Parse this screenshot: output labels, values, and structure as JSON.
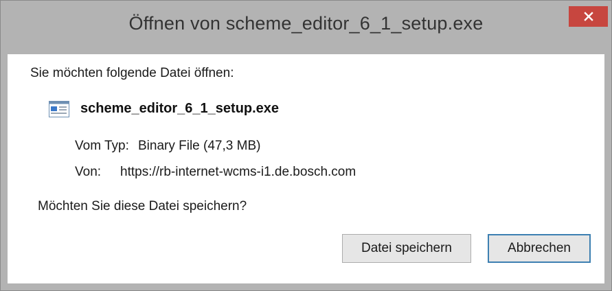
{
  "dialog": {
    "title": "Öffnen von scheme_editor_6_1_setup.exe",
    "close_icon": "close-icon"
  },
  "content": {
    "prompt": "Sie möchten folgende Datei öffnen:",
    "file_icon": "executable-file-icon",
    "filename": "scheme_editor_6_1_setup.exe",
    "type_label": "Vom Typ:",
    "type_value": "Binary File (47,3 MB)",
    "from_label": "Von:",
    "from_value": "https://rb-internet-wcms-i1.de.bosch.com",
    "question": "Möchten Sie diese Datei speichern?"
  },
  "buttons": {
    "save_label": "Datei speichern",
    "cancel_label": "Abbrechen"
  },
  "colors": {
    "titlebar": "#b3b3b3",
    "close_button": "#c7463f",
    "default_button_border": "#3c7fb1"
  }
}
